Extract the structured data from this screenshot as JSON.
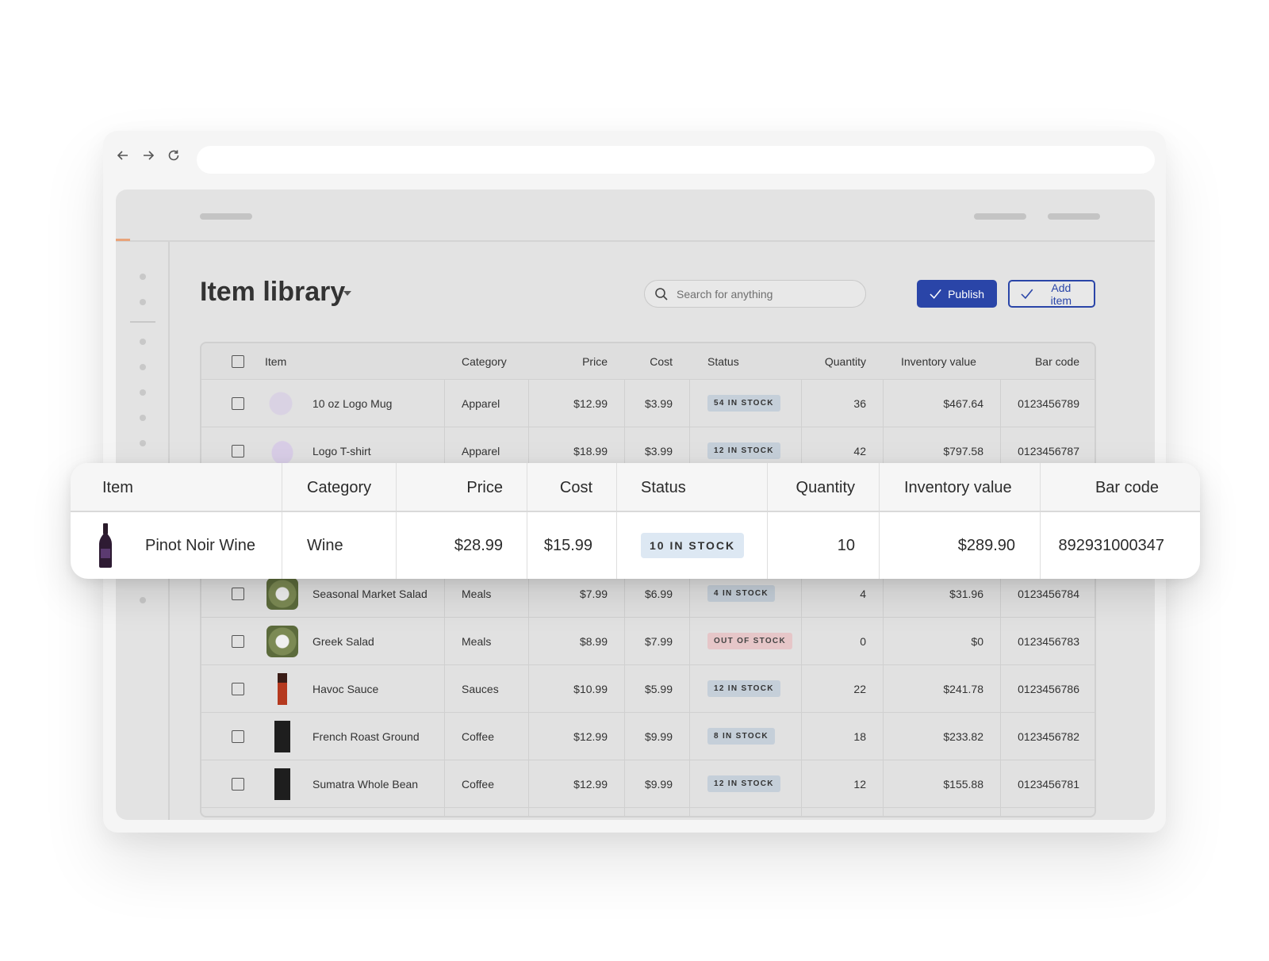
{
  "page": {
    "title": "Item library"
  },
  "search": {
    "placeholder": "Search for anything"
  },
  "toolbar": {
    "publish_label": "Publish",
    "add_item_label": "Add item"
  },
  "table": {
    "columns": [
      "Item",
      "Category",
      "Price",
      "Cost",
      "Status",
      "Quantity",
      "Inventory value",
      "Bar code"
    ],
    "rows": [
      {
        "item": "10 oz Logo Mug",
        "category": "Apparel",
        "price": "$12.99",
        "cost": "$3.99",
        "status": "54 IN STOCK",
        "quantity": "36",
        "inventory_value": "$467.64",
        "bar_code": "0123456789"
      },
      {
        "item": "Logo T-shirt",
        "category": "Apparel",
        "price": "$18.99",
        "cost": "$3.99",
        "status": "12 IN STOCK",
        "quantity": "42",
        "inventory_value": "$797.58",
        "bar_code": "0123456787"
      },
      {
        "item": "Seasonal Market Salad",
        "category": "Meals",
        "price": "$7.99",
        "cost": "$6.99",
        "status": "4 IN STOCK",
        "quantity": "4",
        "inventory_value": "$31.96",
        "bar_code": "0123456784"
      },
      {
        "item": "Greek Salad",
        "category": "Meals",
        "price": "$8.99",
        "cost": "$7.99",
        "status": "OUT OF STOCK",
        "quantity": "0",
        "inventory_value": "$0",
        "bar_code": "0123456783"
      },
      {
        "item": "Havoc Sauce",
        "category": "Sauces",
        "price": "$10.99",
        "cost": "$5.99",
        "status": "12 IN STOCK",
        "quantity": "22",
        "inventory_value": "$241.78",
        "bar_code": "0123456786"
      },
      {
        "item": "French Roast Ground",
        "category": "Coffee",
        "price": "$12.99",
        "cost": "$9.99",
        "status": "8 IN STOCK",
        "quantity": "18",
        "inventory_value": "$233.82",
        "bar_code": "0123456782"
      },
      {
        "item": "Sumatra Whole Bean",
        "category": "Coffee",
        "price": "$12.99",
        "cost": "$9.99",
        "status": "12 IN STOCK",
        "quantity": "12",
        "inventory_value": "$155.88",
        "bar_code": "0123456781"
      }
    ]
  },
  "highlight": {
    "columns": [
      "Item",
      "Category",
      "Price",
      "Cost",
      "Status",
      "Quantity",
      "Inventory value",
      "Bar code"
    ],
    "row": {
      "item": "Pinot Noir Wine",
      "category": "Wine",
      "price": "$28.99",
      "cost": "$15.99",
      "status": "10 IN STOCK",
      "quantity": "10",
      "inventory_value": "$289.90",
      "bar_code": "892931000347"
    }
  },
  "colors": {
    "primary": "#2a45a8",
    "badge_in_stock": "#c5cfd9",
    "badge_out_of_stock": "#e6c6c8",
    "highlight_badge": "#dde8f3"
  },
  "icons": {
    "back": "arrow-left-icon",
    "forward": "arrow-right-icon",
    "reload": "reload-icon",
    "search": "search-icon",
    "check": "check-icon",
    "caret": "caret-down-icon"
  }
}
